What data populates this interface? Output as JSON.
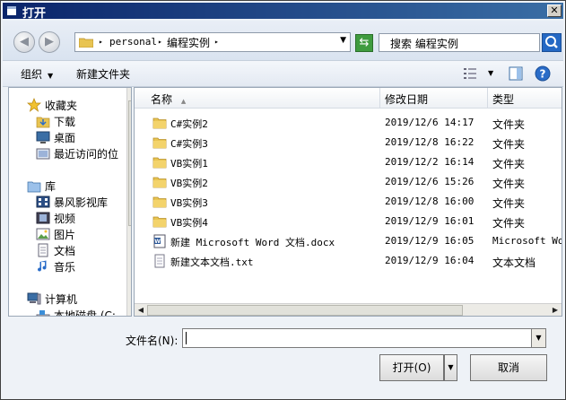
{
  "window": {
    "title": "打开"
  },
  "address": {
    "crumbs": [
      "personal",
      "编程实例"
    ],
    "search_placeholder": "搜索 编程实例"
  },
  "toolbar": {
    "organize": "组织",
    "new_folder": "新建文件夹"
  },
  "nav": {
    "favorites": {
      "label": "收藏夹",
      "items": [
        "下载",
        "桌面",
        "最近访问的位"
      ]
    },
    "library": {
      "label": "库",
      "items": [
        "暴风影视库",
        "视频",
        "图片",
        "文档",
        "音乐"
      ]
    },
    "computer": {
      "label": "计算机",
      "items": [
        "本地磁盘 (C:"
      ]
    }
  },
  "columns": {
    "name": "名称",
    "date": "修改日期",
    "type": "类型"
  },
  "files": [
    {
      "name": "C#实例2",
      "date": "2019/12/6 14:17",
      "type": "文件夹",
      "icon": "folder-icon"
    },
    {
      "name": "C#实例3",
      "date": "2019/12/8 16:22",
      "type": "文件夹",
      "icon": "folder-icon"
    },
    {
      "name": "VB实例1",
      "date": "2019/12/2 16:14",
      "type": "文件夹",
      "icon": "folder-icon"
    },
    {
      "name": "VB实例2",
      "date": "2019/12/6 15:26",
      "type": "文件夹",
      "icon": "folder-icon"
    },
    {
      "name": "VB实例3",
      "date": "2019/12/8 16:00",
      "type": "文件夹",
      "icon": "folder-icon"
    },
    {
      "name": "VB实例4",
      "date": "2019/12/9 16:01",
      "type": "文件夹",
      "icon": "folder-icon"
    },
    {
      "name": "新建 Microsoft Word 文档.docx",
      "date": "2019/12/9 16:05",
      "type": "Microsoft Wor",
      "icon": "word-doc-icon"
    },
    {
      "name": "新建文本文档.txt",
      "date": "2019/12/9 16:04",
      "type": "文本文档",
      "icon": "text-file-icon"
    }
  ],
  "bottom": {
    "filename_label": "文件名(N):",
    "filename_value": "",
    "open_label": "打开(O)",
    "cancel_label": "取消"
  }
}
